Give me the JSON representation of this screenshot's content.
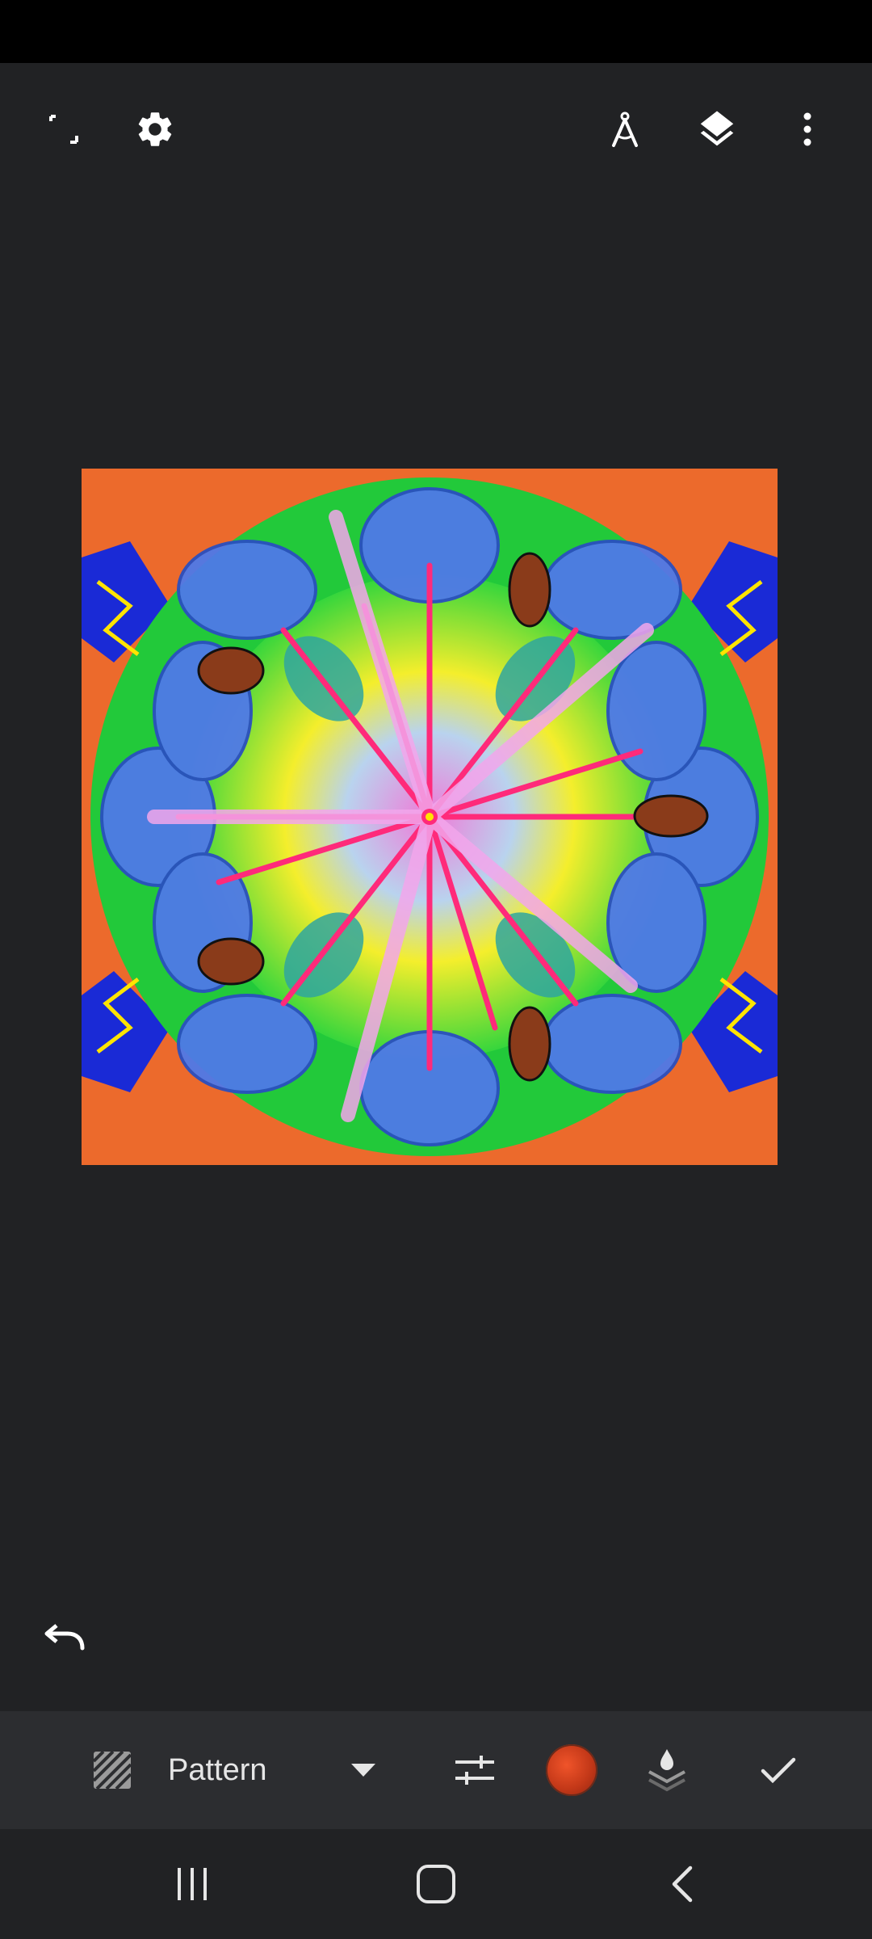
{
  "top_toolbar": {
    "fullscreen_icon": "fullscreen-exit-icon",
    "settings_icon": "gear-icon",
    "ruler_icon": "compass-icon",
    "layers_icon": "layers-icon",
    "more_icon": "more-vert-icon"
  },
  "canvas": {
    "description_icon": "kaleidoscope-drawing",
    "background_color": "#ec6a2c"
  },
  "undo_icon": "undo-icon",
  "bottom_toolbar": {
    "brush_type_icon": "pattern-brush-icon",
    "brush_type_label": "Pattern",
    "dropdown_icon": "triangle-down-icon",
    "adjust_icon": "sliders-icon",
    "color_swatch": "#d63e1d",
    "fill_icon": "paint-bucket-layer-icon",
    "confirm_icon": "check-icon"
  },
  "nav_bar": {
    "recents_icon": "recents-icon",
    "home_icon": "home-icon",
    "back_icon": "back-icon"
  }
}
